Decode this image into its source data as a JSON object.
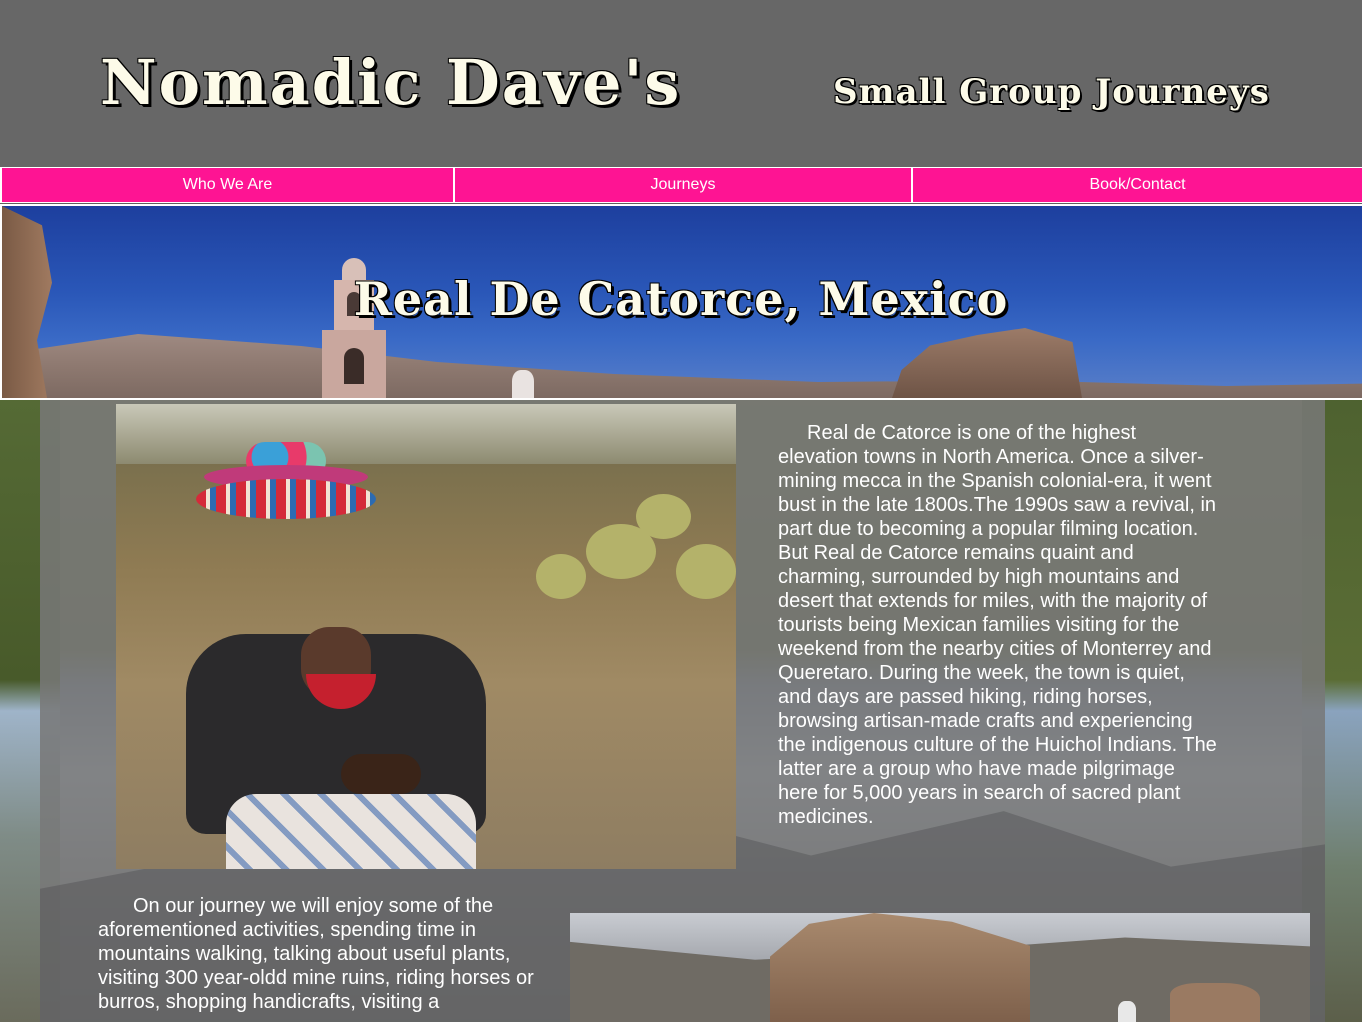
{
  "header": {
    "brand": "Nomadic Dave's",
    "tagline": "Small Group Journeys"
  },
  "nav": {
    "items": [
      {
        "label": "Who We Are"
      },
      {
        "label": "Journeys"
      },
      {
        "label": "Book/Contact"
      }
    ]
  },
  "banner": {
    "title": "Real De Catorce, Mexico"
  },
  "content": {
    "intro": "Real de Catorce is one of the highest elevation towns in North America. Once a silver-mining mecca in the Spanish colonial-era, it went bust in the late 1800s.The 1990s saw a revival, in part due to becoming a popular filming location. But Real de Catorce remains quaint and charming, surrounded by high mountains and desert that extends for miles, with the majority of tourists being Mexican families visiting for the weekend from the nearby cities of Monterrey and Queretaro. During the week, the town is quiet, and days are passed hiking, riding horses, browsing artisan-made crafts and experiencing the indigenous culture of the Huichol Indians. The latter are a group who have made pilgrimage here for 5,000 years in search of sacred plant medicines.",
    "journey": "On our journey we will enjoy some of the aforementioned activities, spending time in mountains walking, talking about useful plants, visiting 300 year-oldd mine ruins, riding horses or burros, shopping handicrafts, visiting a"
  },
  "colors": {
    "header_bg": "#676767",
    "nav_accent": "#fe1493",
    "title_text": "#fdfbe9"
  }
}
